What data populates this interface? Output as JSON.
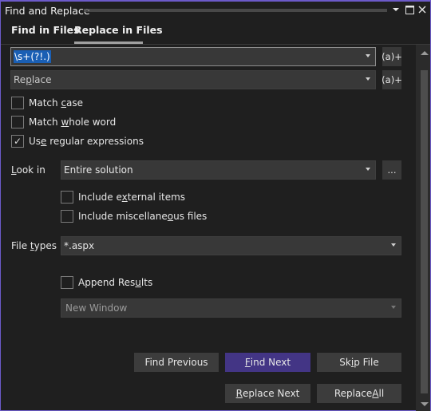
{
  "window": {
    "title": "Find and Replace",
    "icons": [
      "dropdown-icon",
      "maximize-icon",
      "close-icon"
    ]
  },
  "tabs": [
    {
      "label": "Find in Files",
      "active": false
    },
    {
      "label": "Replace in Files",
      "active": true
    }
  ],
  "find": {
    "value": "\\s+(?!.)",
    "regex_builder_label": "(a)+"
  },
  "replace": {
    "placeholder_pre": "Re",
    "placeholder_ul": "p",
    "placeholder_post": "lace",
    "regex_builder_label": "(a)+"
  },
  "options": {
    "match_case": {
      "pre": "Match ",
      "ul": "c",
      "post": "ase",
      "checked": false
    },
    "match_whole_word": {
      "pre": "Match ",
      "ul": "w",
      "post": "hole word",
      "checked": false
    },
    "use_regex": {
      "pre": "Us",
      "ul": "e",
      "post": " regular expressions",
      "checked": true,
      "check_glyph": "✓"
    }
  },
  "look_in": {
    "label_ul": "L",
    "label_post": "ook in",
    "value": "Entire solution",
    "browse_label": "..."
  },
  "include": {
    "external": {
      "pre": "Include e",
      "ul": "x",
      "post": "ternal items",
      "checked": false
    },
    "misc": {
      "pre": "Include miscellane",
      "ul": "o",
      "post": "us files",
      "checked": false
    }
  },
  "file_types": {
    "label_pre": "File ",
    "label_ul": "t",
    "label_post": "ypes",
    "value": "*.aspx"
  },
  "append_results": {
    "pre": "Append Res",
    "ul": "u",
    "post": "lts",
    "checked": false
  },
  "result_window": {
    "value": "New Window",
    "disabled": true
  },
  "buttons": {
    "find_previous": "Find Previous",
    "find_next_ul": "F",
    "find_next_post": "ind Next",
    "skip_file_pre": "Sk",
    "skip_file_ul": "i",
    "skip_file_post": "p File",
    "replace_next_ul": "R",
    "replace_next_post": "eplace Next",
    "replace_all_pre": "Replace ",
    "replace_all_ul": "A",
    "replace_all_post": "ll"
  },
  "colors": {
    "accent": "#433585",
    "border": "#6c5ac9",
    "selection": "#1a5fb4"
  }
}
